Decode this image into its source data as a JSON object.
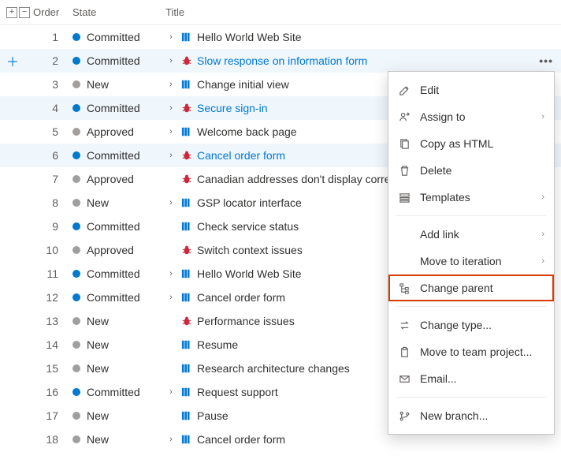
{
  "columns": {
    "order": "Order",
    "state": "State",
    "title": "Title"
  },
  "rows": [
    {
      "order": 1,
      "state": "Committed",
      "dot": "blue",
      "chev": true,
      "type": "pbi",
      "title": "Hello World Web Site",
      "link": false,
      "selected": false,
      "more": false,
      "add": false
    },
    {
      "order": 2,
      "state": "Committed",
      "dot": "blue",
      "chev": true,
      "type": "bug",
      "title": "Slow response on information form",
      "link": true,
      "selected": true,
      "more": true,
      "add": true
    },
    {
      "order": 3,
      "state": "New",
      "dot": "gray",
      "chev": true,
      "type": "pbi",
      "title": "Change initial view",
      "link": false,
      "selected": false,
      "more": false,
      "add": false
    },
    {
      "order": 4,
      "state": "Committed",
      "dot": "blue",
      "chev": true,
      "type": "bug",
      "title": "Secure sign-in",
      "link": true,
      "selected": true,
      "more": true,
      "add": false
    },
    {
      "order": 5,
      "state": "Approved",
      "dot": "gray",
      "chev": true,
      "type": "pbi",
      "title": "Welcome back page",
      "link": false,
      "selected": false,
      "more": false,
      "add": false
    },
    {
      "order": 6,
      "state": "Committed",
      "dot": "blue",
      "chev": true,
      "type": "bug",
      "title": "Cancel order form",
      "link": true,
      "selected": true,
      "more": true,
      "add": false
    },
    {
      "order": 7,
      "state": "Approved",
      "dot": "gray",
      "chev": false,
      "type": "bug",
      "title": "Canadian addresses don't display correctly",
      "link": false,
      "selected": false,
      "more": false,
      "add": false
    },
    {
      "order": 8,
      "state": "New",
      "dot": "gray",
      "chev": true,
      "type": "pbi",
      "title": "GSP locator interface",
      "link": false,
      "selected": false,
      "more": false,
      "add": false
    },
    {
      "order": 9,
      "state": "Committed",
      "dot": "blue",
      "chev": false,
      "type": "pbi",
      "title": "Check service status",
      "link": false,
      "selected": false,
      "more": false,
      "add": false
    },
    {
      "order": 10,
      "state": "Approved",
      "dot": "gray",
      "chev": false,
      "type": "bug",
      "title": "Switch context issues",
      "link": false,
      "selected": false,
      "more": false,
      "add": false
    },
    {
      "order": 11,
      "state": "Committed",
      "dot": "blue",
      "chev": true,
      "type": "pbi",
      "title": "Hello World Web Site",
      "link": false,
      "selected": false,
      "more": false,
      "add": false
    },
    {
      "order": 12,
      "state": "Committed",
      "dot": "blue",
      "chev": true,
      "type": "pbi",
      "title": "Cancel order form",
      "link": false,
      "selected": false,
      "more": false,
      "add": false
    },
    {
      "order": 13,
      "state": "New",
      "dot": "gray",
      "chev": false,
      "type": "bug",
      "title": "Performance issues",
      "link": false,
      "selected": false,
      "more": false,
      "add": false
    },
    {
      "order": 14,
      "state": "New",
      "dot": "gray",
      "chev": false,
      "type": "pbi",
      "title": "Resume",
      "link": false,
      "selected": false,
      "more": false,
      "add": false
    },
    {
      "order": 15,
      "state": "New",
      "dot": "gray",
      "chev": false,
      "type": "pbi",
      "title": "Research architecture changes",
      "link": false,
      "selected": false,
      "more": false,
      "add": false
    },
    {
      "order": 16,
      "state": "Committed",
      "dot": "blue",
      "chev": true,
      "type": "pbi",
      "title": "Request support",
      "link": false,
      "selected": false,
      "more": false,
      "add": false
    },
    {
      "order": 17,
      "state": "New",
      "dot": "gray",
      "chev": false,
      "type": "pbi",
      "title": "Pause",
      "link": false,
      "selected": false,
      "more": false,
      "add": false
    },
    {
      "order": 18,
      "state": "New",
      "dot": "gray",
      "chev": true,
      "type": "pbi",
      "title": "Cancel order form",
      "link": false,
      "selected": false,
      "more": false,
      "add": false
    }
  ],
  "menu": {
    "groups": [
      [
        {
          "icon": "edit",
          "label": "Edit",
          "sub": false,
          "hl": false
        },
        {
          "icon": "assign",
          "label": "Assign to",
          "sub": true,
          "hl": false
        },
        {
          "icon": "copy",
          "label": "Copy as HTML",
          "sub": false,
          "hl": false
        },
        {
          "icon": "delete",
          "label": "Delete",
          "sub": false,
          "hl": false
        },
        {
          "icon": "template",
          "label": "Templates",
          "sub": true,
          "hl": false
        }
      ],
      [
        {
          "icon": "",
          "label": "Add link",
          "sub": true,
          "hl": false
        },
        {
          "icon": "",
          "label": "Move to iteration",
          "sub": true,
          "hl": false
        },
        {
          "icon": "tree",
          "label": "Change parent",
          "sub": false,
          "hl": true
        }
      ],
      [
        {
          "icon": "swap",
          "label": "Change type...",
          "sub": false,
          "hl": false
        },
        {
          "icon": "clipboard",
          "label": "Move to team project...",
          "sub": false,
          "hl": false
        },
        {
          "icon": "mail",
          "label": "Email...",
          "sub": false,
          "hl": false
        }
      ],
      [
        {
          "icon": "branch",
          "label": "New branch...",
          "sub": false,
          "hl": false
        }
      ]
    ]
  }
}
